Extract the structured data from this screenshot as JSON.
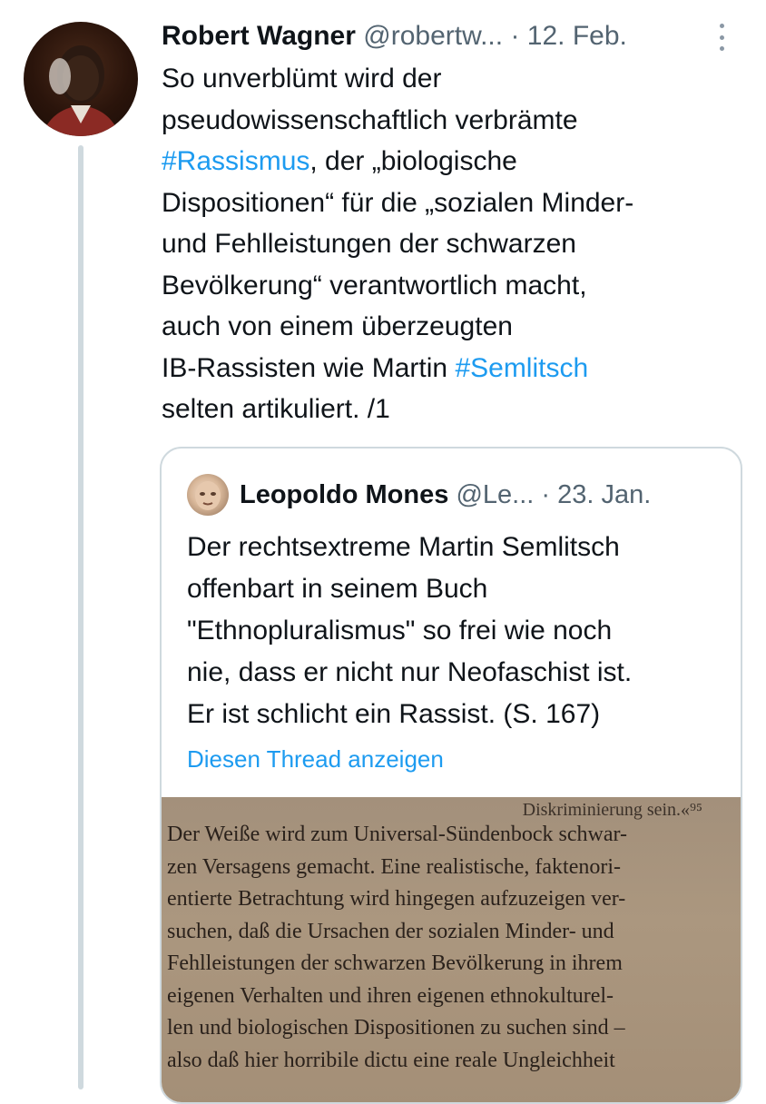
{
  "tweet": {
    "author_name": "Robert Wagner",
    "handle": "@robertw...",
    "separator": "·",
    "date": "12. Feb.",
    "more_icon": "more-vertical-icon",
    "text_lines": [
      [
        "So unverblümt wird der"
      ],
      [
        "pseudowissenschaftlich verbrämte"
      ],
      [
        "#Rassismus",
        ", der „biologische"
      ],
      [
        "Dispositionen“ für die „sozialen Minder-"
      ],
      [
        "und Fehlleistungen der schwarzen"
      ],
      [
        "Bevölkerung“ verantwortlich macht,"
      ],
      [
        "auch von einem überzeugten"
      ],
      [
        "IB-Rassisten wie Martin ",
        "#Semlitsch"
      ],
      [
        "selten artikuliert. /1"
      ]
    ]
  },
  "quoted_tweet": {
    "author_name": "Leopoldo Mones",
    "handle": "@Le...",
    "separator": "·",
    "date": "23. Jan.",
    "text_lines": [
      "Der rechtsextreme Martin Semlitsch",
      "offenbart in seinem Buch",
      "\"Ethnopluralismus\" so frei wie noch",
      "nie, dass er nicht nur Neofaschist ist.",
      "Er ist schlicht ein Rassist. (S. 167)"
    ],
    "thread_link": "Diesen Thread anzeigen",
    "book_lines": [
      "Diskriminierung sein.«⁹⁵",
      "Der Weiße wird zum Universal-Sündenbock schwar-",
      "zen Versagens gemacht. Eine realistische, faktenori-",
      "entierte Betrachtung wird hingegen aufzuzeigen ver-",
      "suchen, daß die Ursachen der sozialen Minder- und",
      "Fehlleistungen der schwarzen Bevölkerung in ihrem",
      "eigenen Verhalten und ihren eigenen ethnokulturel-",
      "len und biologischen Dispositionen zu suchen sind –",
      "also daß hier horribile dictu eine reale Ungleichheit"
    ]
  },
  "colors": {
    "link": "#1d9bf0",
    "text": "#0f1419",
    "secondary": "#536471",
    "border": "#cfd9de"
  }
}
